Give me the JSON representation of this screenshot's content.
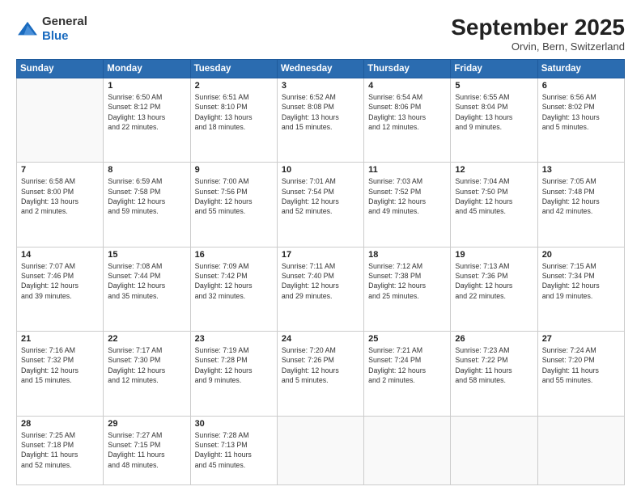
{
  "header": {
    "logo_line1": "General",
    "logo_line2": "Blue",
    "month_title": "September 2025",
    "location": "Orvin, Bern, Switzerland"
  },
  "weekdays": [
    "Sunday",
    "Monday",
    "Tuesday",
    "Wednesday",
    "Thursday",
    "Friday",
    "Saturday"
  ],
  "weeks": [
    [
      {
        "day": "",
        "info": ""
      },
      {
        "day": "1",
        "info": "Sunrise: 6:50 AM\nSunset: 8:12 PM\nDaylight: 13 hours\nand 22 minutes."
      },
      {
        "day": "2",
        "info": "Sunrise: 6:51 AM\nSunset: 8:10 PM\nDaylight: 13 hours\nand 18 minutes."
      },
      {
        "day": "3",
        "info": "Sunrise: 6:52 AM\nSunset: 8:08 PM\nDaylight: 13 hours\nand 15 minutes."
      },
      {
        "day": "4",
        "info": "Sunrise: 6:54 AM\nSunset: 8:06 PM\nDaylight: 13 hours\nand 12 minutes."
      },
      {
        "day": "5",
        "info": "Sunrise: 6:55 AM\nSunset: 8:04 PM\nDaylight: 13 hours\nand 9 minutes."
      },
      {
        "day": "6",
        "info": "Sunrise: 6:56 AM\nSunset: 8:02 PM\nDaylight: 13 hours\nand 5 minutes."
      }
    ],
    [
      {
        "day": "7",
        "info": "Sunrise: 6:58 AM\nSunset: 8:00 PM\nDaylight: 13 hours\nand 2 minutes."
      },
      {
        "day": "8",
        "info": "Sunrise: 6:59 AM\nSunset: 7:58 PM\nDaylight: 12 hours\nand 59 minutes."
      },
      {
        "day": "9",
        "info": "Sunrise: 7:00 AM\nSunset: 7:56 PM\nDaylight: 12 hours\nand 55 minutes."
      },
      {
        "day": "10",
        "info": "Sunrise: 7:01 AM\nSunset: 7:54 PM\nDaylight: 12 hours\nand 52 minutes."
      },
      {
        "day": "11",
        "info": "Sunrise: 7:03 AM\nSunset: 7:52 PM\nDaylight: 12 hours\nand 49 minutes."
      },
      {
        "day": "12",
        "info": "Sunrise: 7:04 AM\nSunset: 7:50 PM\nDaylight: 12 hours\nand 45 minutes."
      },
      {
        "day": "13",
        "info": "Sunrise: 7:05 AM\nSunset: 7:48 PM\nDaylight: 12 hours\nand 42 minutes."
      }
    ],
    [
      {
        "day": "14",
        "info": "Sunrise: 7:07 AM\nSunset: 7:46 PM\nDaylight: 12 hours\nand 39 minutes."
      },
      {
        "day": "15",
        "info": "Sunrise: 7:08 AM\nSunset: 7:44 PM\nDaylight: 12 hours\nand 35 minutes."
      },
      {
        "day": "16",
        "info": "Sunrise: 7:09 AM\nSunset: 7:42 PM\nDaylight: 12 hours\nand 32 minutes."
      },
      {
        "day": "17",
        "info": "Sunrise: 7:11 AM\nSunset: 7:40 PM\nDaylight: 12 hours\nand 29 minutes."
      },
      {
        "day": "18",
        "info": "Sunrise: 7:12 AM\nSunset: 7:38 PM\nDaylight: 12 hours\nand 25 minutes."
      },
      {
        "day": "19",
        "info": "Sunrise: 7:13 AM\nSunset: 7:36 PM\nDaylight: 12 hours\nand 22 minutes."
      },
      {
        "day": "20",
        "info": "Sunrise: 7:15 AM\nSunset: 7:34 PM\nDaylight: 12 hours\nand 19 minutes."
      }
    ],
    [
      {
        "day": "21",
        "info": "Sunrise: 7:16 AM\nSunset: 7:32 PM\nDaylight: 12 hours\nand 15 minutes."
      },
      {
        "day": "22",
        "info": "Sunrise: 7:17 AM\nSunset: 7:30 PM\nDaylight: 12 hours\nand 12 minutes."
      },
      {
        "day": "23",
        "info": "Sunrise: 7:19 AM\nSunset: 7:28 PM\nDaylight: 12 hours\nand 9 minutes."
      },
      {
        "day": "24",
        "info": "Sunrise: 7:20 AM\nSunset: 7:26 PM\nDaylight: 12 hours\nand 5 minutes."
      },
      {
        "day": "25",
        "info": "Sunrise: 7:21 AM\nSunset: 7:24 PM\nDaylight: 12 hours\nand 2 minutes."
      },
      {
        "day": "26",
        "info": "Sunrise: 7:23 AM\nSunset: 7:22 PM\nDaylight: 11 hours\nand 58 minutes."
      },
      {
        "day": "27",
        "info": "Sunrise: 7:24 AM\nSunset: 7:20 PM\nDaylight: 11 hours\nand 55 minutes."
      }
    ],
    [
      {
        "day": "28",
        "info": "Sunrise: 7:25 AM\nSunset: 7:18 PM\nDaylight: 11 hours\nand 52 minutes."
      },
      {
        "day": "29",
        "info": "Sunrise: 7:27 AM\nSunset: 7:15 PM\nDaylight: 11 hours\nand 48 minutes."
      },
      {
        "day": "30",
        "info": "Sunrise: 7:28 AM\nSunset: 7:13 PM\nDaylight: 11 hours\nand 45 minutes."
      },
      {
        "day": "",
        "info": ""
      },
      {
        "day": "",
        "info": ""
      },
      {
        "day": "",
        "info": ""
      },
      {
        "day": "",
        "info": ""
      }
    ]
  ]
}
